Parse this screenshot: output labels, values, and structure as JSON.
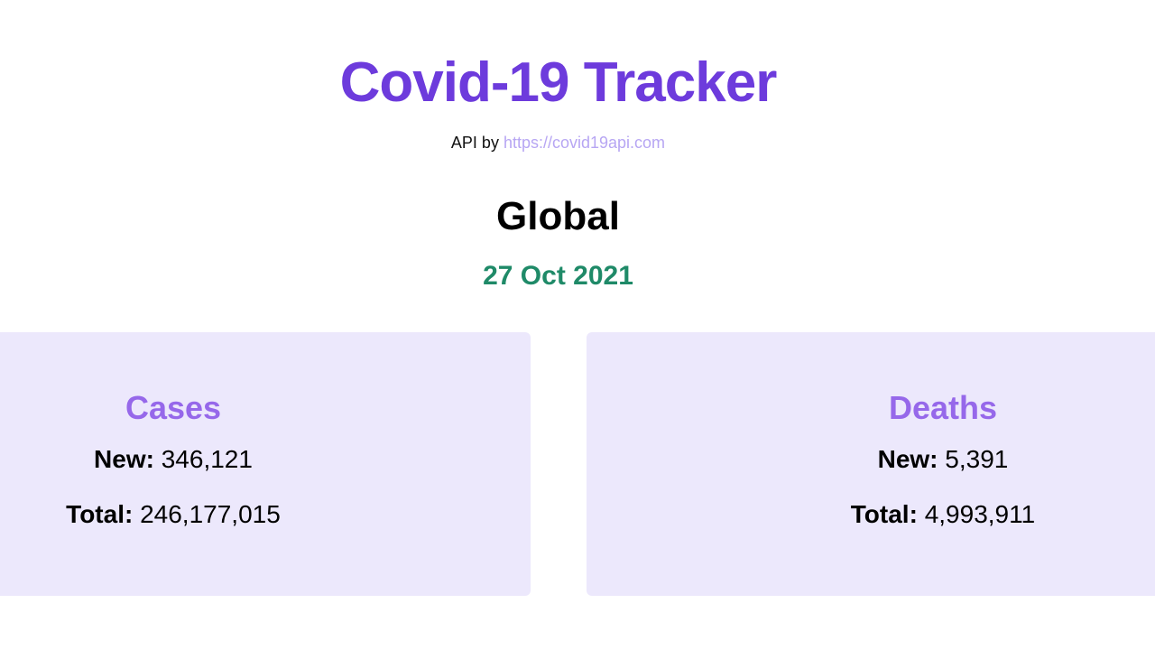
{
  "header": {
    "title": "Covid-19 Tracker",
    "api_prefix": "API by ",
    "api_link": "https://covid19api.com"
  },
  "summary": {
    "region": "Global",
    "date": "27 Oct 2021"
  },
  "cards": {
    "cases": {
      "title": "Cases",
      "new_label": "New:",
      "new_value": "346,121",
      "total_label": "Total:",
      "total_value": "246,177,015"
    },
    "deaths": {
      "title": "Deaths",
      "new_label": "New:",
      "new_value": "5,391",
      "total_label": "Total:",
      "total_value": "4,993,911"
    }
  },
  "colors": {
    "title": "#6d3bdc",
    "link": "#b7a6f3",
    "date": "#1f8a68",
    "card_bg": "#ece8fc",
    "card_title": "#9668ea"
  }
}
